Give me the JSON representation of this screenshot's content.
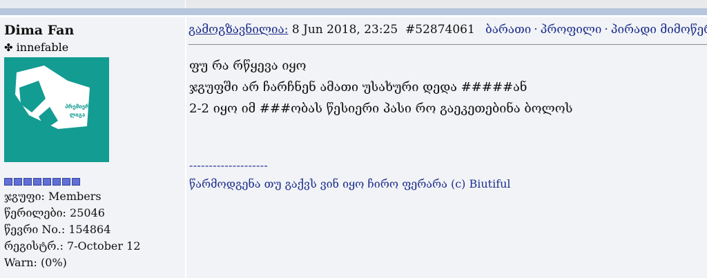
{
  "post": {
    "author": {
      "name": "Dima Fan",
      "title_icon": "clover-icon",
      "title": "innefable",
      "rank_pips": 8,
      "avatar_text": [
        "პრემიერ",
        "ლიგა"
      ],
      "stats": [
        "ჯგუფი: Members",
        "წერილები: 25046",
        "წევრი No.: 154864",
        "რეგისტრ.: 7-October 12",
        "Warn: (0%)"
      ]
    },
    "header": {
      "sent_label": "გამოგზავნილია:",
      "datetime": "8 Jun 2018, 23:25",
      "post_id": "#52874061",
      "links": [
        "ბარათი",
        "პროფილი",
        "პირადი მიმოწერა"
      ]
    },
    "body": [
      "ფუ რა რწყევა იყო",
      "ჯგუფში არ ჩარჩნენ ამათი უსახური დედა #####ან",
      "2-2 იყო იმ ###ობას წესიერი პასი რო გაეკეთებინა ბოლოს"
    ],
    "signature": {
      "separator": "--------------------",
      "text": "წარმოდგენა თუ გაქვს ვინ იყო ჩირო ფერარა (c) Biutiful"
    }
  },
  "colors": {
    "link": "#1d2e8c",
    "avatar_bg": "#139c92",
    "panel_bg": "#f1f3f6",
    "header_bar": "#b6c6dc",
    "pip": "#6070d6"
  }
}
